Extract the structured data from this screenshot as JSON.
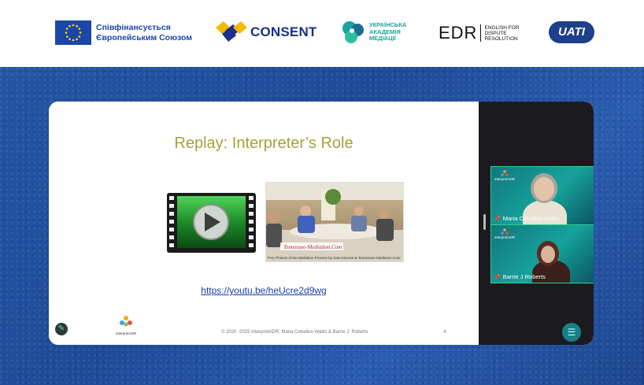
{
  "logos": {
    "eu": {
      "line1": "Співфінансується",
      "line2": "Європейським Союзом"
    },
    "consent": {
      "text": "CONSENT"
    },
    "uam": {
      "line1": "УКРАЇНСЬКА",
      "line2": "АКАДЕМІЯ",
      "line3": "МЕДІАЦІЇ"
    },
    "edr": {
      "big": "EDR",
      "small1": "ENGLISH FOR",
      "small2": "DISPUTE",
      "small3": "RESOLUTION"
    },
    "uati": {
      "text": "UATI"
    }
  },
  "slide": {
    "title": "Replay: Interpreter’s Role",
    "thumb_caption": "Four Phases of the Mediation Process by Jean Munroe & Tennessee-Mediation.Com",
    "thumb_brand": "Tennessee-Mediation.Com",
    "link": "https://youtu.be/heUcre2d9wg",
    "footer": "© 2020 -2025 InterpretADR; Maria Ceballos-Wallis & Barrie J. Roberts",
    "page_number": "4",
    "footer_logo_text": "interpretADR"
  },
  "participants": [
    {
      "name": "Maria Ceballos-Wallis",
      "badge": "interpretADR"
    },
    {
      "name": "Barrie J Roberts",
      "badge": "interpretADR"
    }
  ],
  "colors": {
    "title": "#a2a23a",
    "link": "#1a3fa0",
    "background": "#1f4f9c",
    "active_speaker_border": "#2fd28c"
  }
}
